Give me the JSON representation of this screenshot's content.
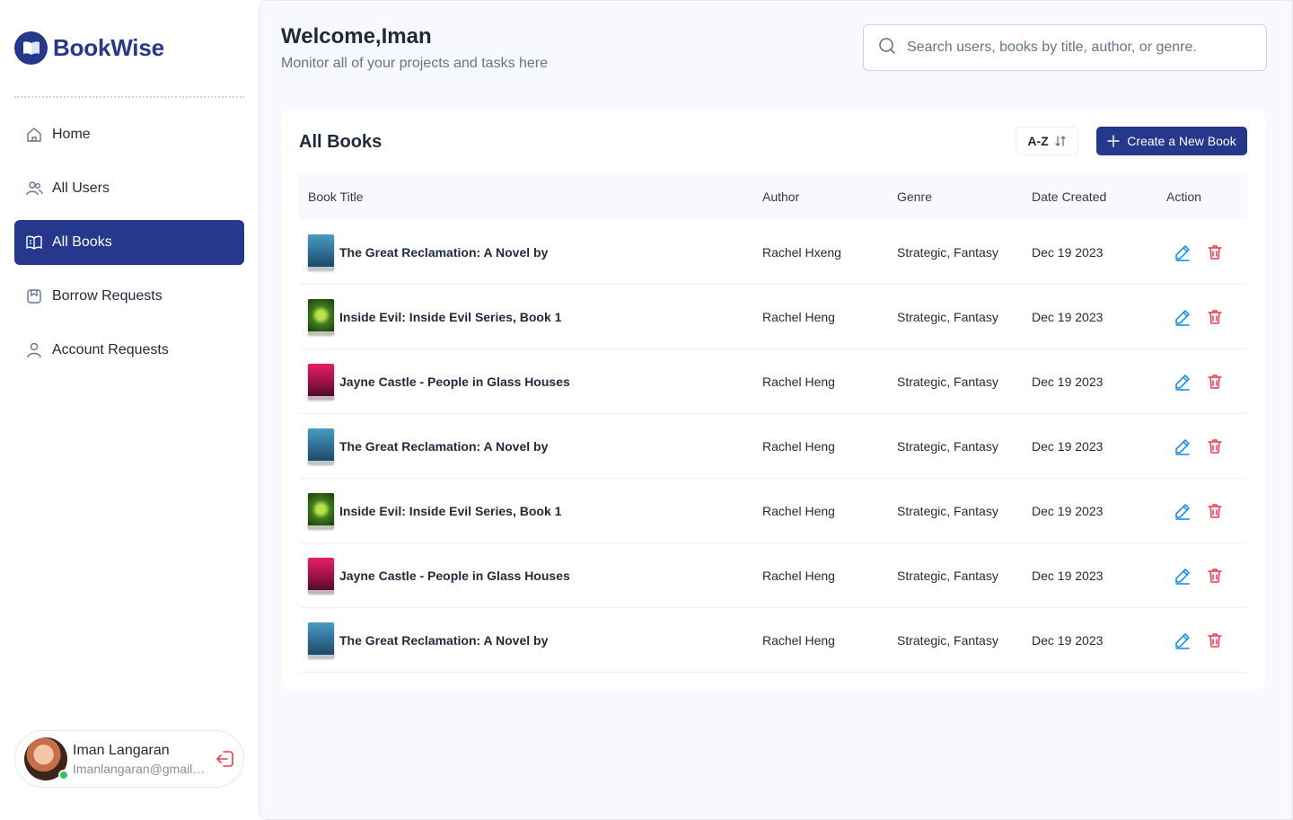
{
  "app": {
    "name": "BookWise"
  },
  "sidebar": {
    "items": [
      {
        "label": "Home",
        "icon": "home-icon",
        "active": false
      },
      {
        "label": "All Users",
        "icon": "users-icon",
        "active": false
      },
      {
        "label": "All Books",
        "icon": "book-icon",
        "active": true
      },
      {
        "label": "Borrow Requests",
        "icon": "borrow-icon",
        "active": false
      },
      {
        "label": "Account Requests",
        "icon": "user-icon",
        "active": false
      }
    ]
  },
  "user": {
    "name": "Iman Langaran",
    "email": "Imanlangaran@gmail.com",
    "status_color": "#2cc664"
  },
  "header": {
    "welcome": "Welcome,Iman",
    "subtitle": "Monitor all of your projects and tasks here"
  },
  "search": {
    "placeholder": "Search users, books by title, author, or genre.",
    "value": ""
  },
  "books": {
    "title": "All Books",
    "sort_label": "A-Z",
    "create_label": "Create a New Book",
    "columns": [
      "Book Title",
      "Author",
      "Genre",
      "Date Created",
      "Action"
    ],
    "rows": [
      {
        "title": "The Great Reclamation: A Novel by",
        "author": "Rachel Hxeng",
        "genre": "Strategic, Fantasy",
        "date": "Dec 19 2023",
        "cover": "reclamation"
      },
      {
        "title": "Inside Evil: Inside Evil Series, Book 1",
        "author": "Rachel Heng",
        "genre": "Strategic, Fantasy",
        "date": "Dec 19 2023",
        "cover": "evil"
      },
      {
        "title": "Jayne Castle - People in Glass Houses",
        "author": "Rachel Heng",
        "genre": "Strategic, Fantasy",
        "date": "Dec 19 2023",
        "cover": "glass"
      },
      {
        "title": "The Great Reclamation: A Novel by",
        "author": "Rachel Heng",
        "genre": "Strategic, Fantasy",
        "date": "Dec 19 2023",
        "cover": "reclamation"
      },
      {
        "title": "Inside Evil: Inside Evil Series, Book 1",
        "author": "Rachel Heng",
        "genre": "Strategic, Fantasy",
        "date": "Dec 19 2023",
        "cover": "evil"
      },
      {
        "title": "Jayne Castle - People in Glass Houses",
        "author": "Rachel Heng",
        "genre": "Strategic, Fantasy",
        "date": "Dec 19 2023",
        "cover": "glass"
      },
      {
        "title": "The Great Reclamation: A Novel by",
        "author": "Rachel Heng",
        "genre": "Strategic, Fantasy",
        "date": "Dec 19 2023",
        "cover": "reclamation"
      }
    ]
  },
  "colors": {
    "brand": "#25388c",
    "edit": "#0089f1",
    "delete": "#ef3a4b",
    "cover_reclamation": "#3a7fa8",
    "cover_evil": "#2f5a16",
    "cover_glass": "#c2185b"
  }
}
